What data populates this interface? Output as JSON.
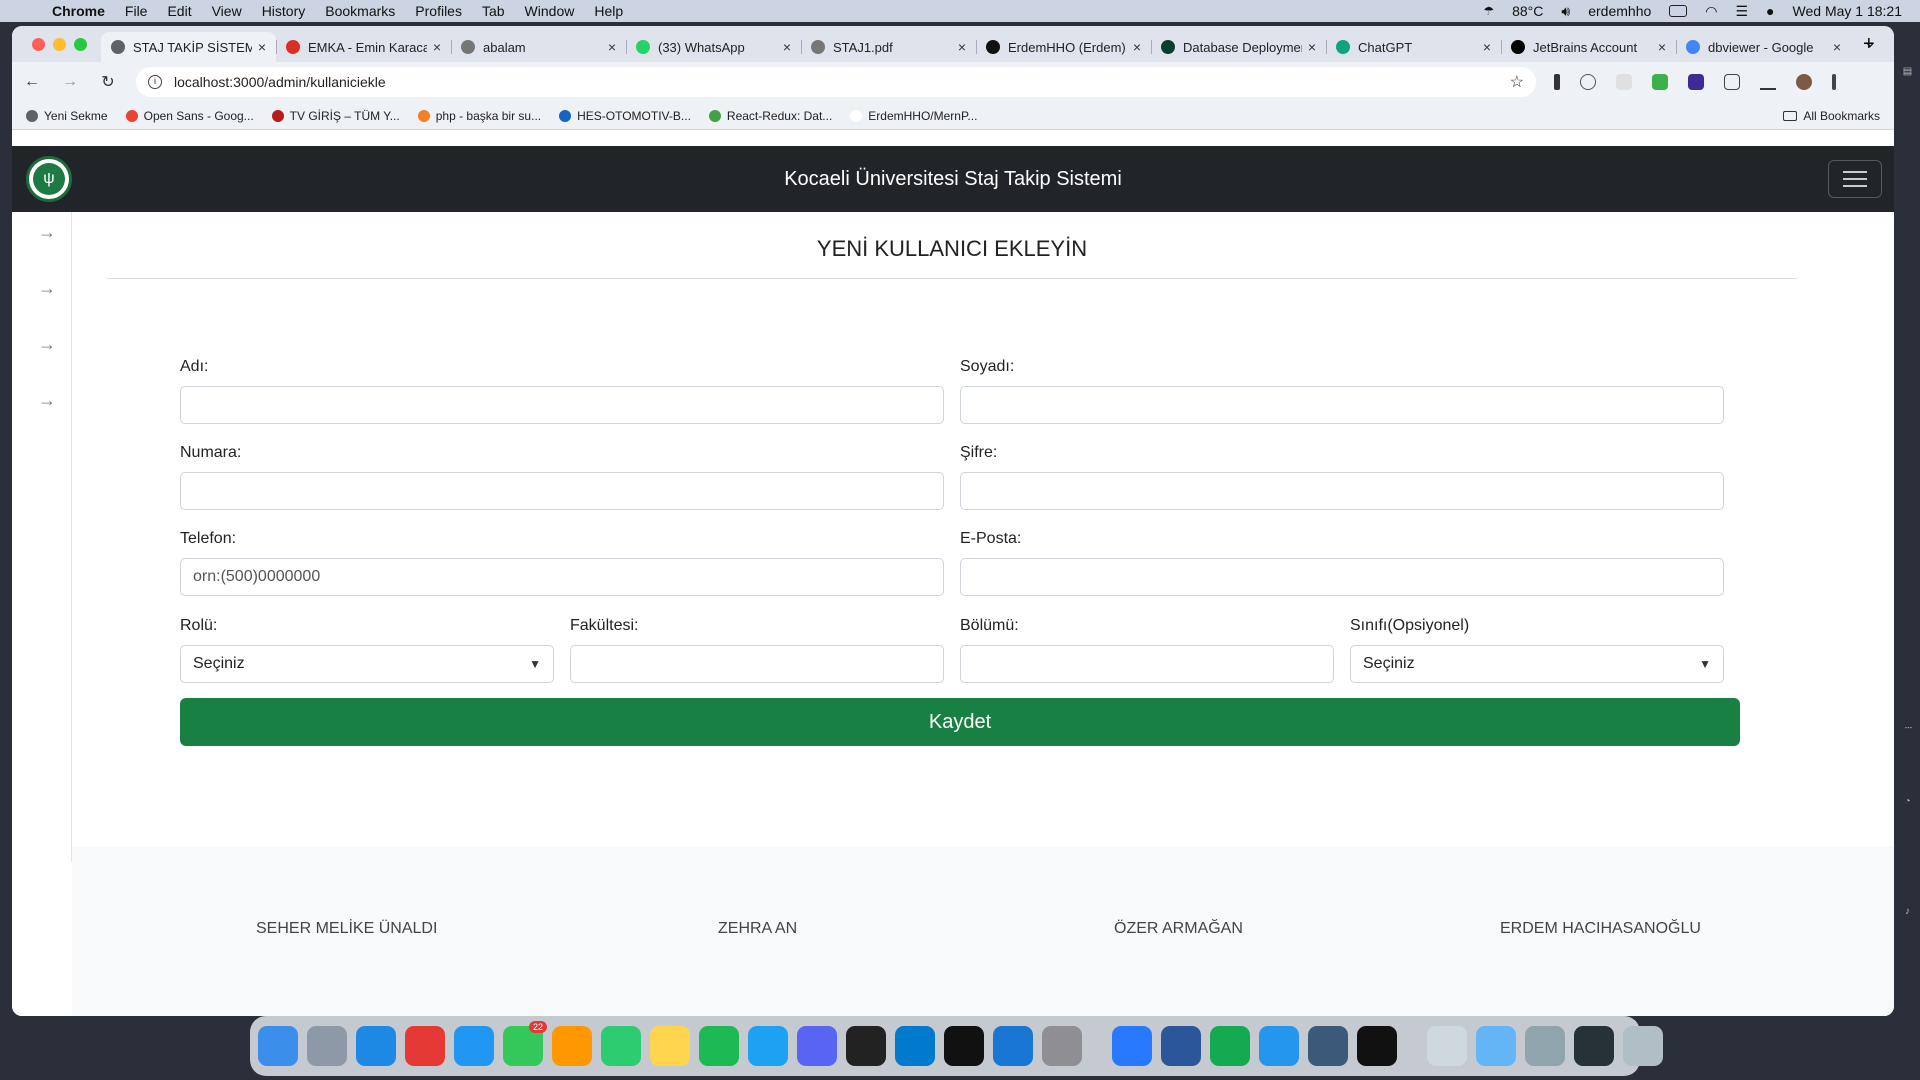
{
  "menubar": {
    "app": "Chrome",
    "items": [
      "File",
      "Edit",
      "View",
      "History",
      "Bookmarks",
      "Profiles",
      "Tab",
      "Window",
      "Help"
    ],
    "temperature": "88°C",
    "user": "erdemhho",
    "datetime": "Wed May 1  18:21"
  },
  "tabs": [
    {
      "title": "STAJ TAKİP SİSTEMİ",
      "color": "#5f6368",
      "active": true
    },
    {
      "title": "EMKA - Emin Karaca",
      "color": "#d93025"
    },
    {
      "title": "abalam",
      "color": "#777777"
    },
    {
      "title": "(33) WhatsApp",
      "color": "#25d366"
    },
    {
      "title": "STAJ1.pdf",
      "color": "#777777"
    },
    {
      "title": "ErdemHHO (Erdem)",
      "color": "#111111"
    },
    {
      "title": "Database Deployments",
      "color": "#0b3d2e"
    },
    {
      "title": "ChatGPT",
      "color": "#10a37f"
    },
    {
      "title": "JetBrains Account",
      "color": "#000000"
    },
    {
      "title": "dbviewer - Google",
      "color": "#4285f4"
    }
  ],
  "address": {
    "url": "localhost:3000/admin/kullaniciekle"
  },
  "bookmarks": [
    {
      "label": "Yeni Sekme",
      "color": "#5f6368"
    },
    {
      "label": "Open Sans - Goog...",
      "color": "#ea4335"
    },
    {
      "label": "TV GİRİŞ – TÜM Y...",
      "color": "#b71c1c"
    },
    {
      "label": "php - başka bir su...",
      "color": "#f48024"
    },
    {
      "label": "HES-OTOMOTIV-B...",
      "color": "#1565c0"
    },
    {
      "label": "React-Redux: Dat...",
      "color": "#43a047"
    },
    {
      "label": "ErdemHHO/MernP...",
      "color": "#ffffff"
    }
  ],
  "all_bookmarks": "All Bookmarks",
  "app": {
    "title": "Kocaeli Üniversitesi Staj Takip Sistemi",
    "heading": "YENİ KULLANICI EKLEYİN",
    "form": {
      "first_name_label": "Adı:",
      "last_name_label": "Soyadı:",
      "number_label": "Numara:",
      "password_label": "Şifre:",
      "phone_label": "Telefon:",
      "phone_placeholder": "orn:(500)0000000",
      "email_label": "E-Posta:",
      "role_label": "Rolü:",
      "role_value": "Seçiniz",
      "faculty_label": "Fakültesi:",
      "department_label": "Bölümü:",
      "class_label": "Sınıfı(Opsiyonel)",
      "class_value": "Seçiniz",
      "save_label": "Kaydet"
    },
    "footer": [
      "SEHER MELİKE ÜNALDI",
      "ZEHRA AN",
      "ÖZER ARMAĞAN",
      "ERDEM HACIHASANOĞLU"
    ]
  },
  "colors": {
    "accent": "#198043",
    "navbar": "#212529"
  },
  "dock": [
    {
      "name": "finder-icon",
      "color": "#3b8eea"
    },
    {
      "name": "launchpad-icon",
      "color": "#8e99a8"
    },
    {
      "name": "safari-icon",
      "color": "#1e88e5"
    },
    {
      "name": "chrome-icon",
      "color": "#e53935"
    },
    {
      "name": "mail-icon",
      "color": "#2196f3"
    },
    {
      "name": "messages-icon",
      "color": "#34c759",
      "badge": "22"
    },
    {
      "name": "photos-icon",
      "color": "#ff9800"
    },
    {
      "name": "facetime-icon",
      "color": "#2ecc71"
    },
    {
      "name": "notes-icon",
      "color": "#ffd54f"
    },
    {
      "name": "spotify-icon",
      "color": "#1db954"
    },
    {
      "name": "twitter-icon",
      "color": "#1da1f2"
    },
    {
      "name": "discord-icon",
      "color": "#5865f2"
    },
    {
      "name": "terminal-icon",
      "color": "#222222"
    },
    {
      "name": "vscode-icon",
      "color": "#007acc"
    },
    {
      "name": "webstorm-icon",
      "color": "#111111"
    },
    {
      "name": "xcode-icon",
      "color": "#1976d2"
    },
    {
      "name": "settings-icon",
      "color": "#8e8e93"
    },
    {
      "name": "fork-icon",
      "color": "#2979ff"
    },
    {
      "name": "word-icon",
      "color": "#2b579a"
    },
    {
      "name": "mongodb-icon",
      "color": "#13aa52"
    },
    {
      "name": "docker-icon",
      "color": "#2496ed"
    },
    {
      "name": "mysql-workbench-icon",
      "color": "#3b5a7a"
    },
    {
      "name": "datagrip-icon",
      "color": "#111111"
    },
    {
      "name": "preview-icon",
      "color": "#cfd8dc"
    },
    {
      "name": "folder-icon",
      "color": "#64b5f6"
    },
    {
      "name": "screenshot-icon",
      "color": "#90a4ae"
    },
    {
      "name": "screen-icon",
      "color": "#263238"
    },
    {
      "name": "trash-icon",
      "color": "#b0bec5"
    }
  ]
}
